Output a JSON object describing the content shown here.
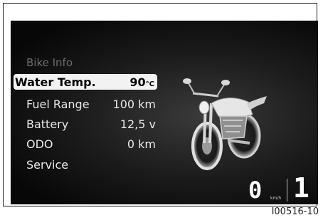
{
  "menu": {
    "title": "Bike Info",
    "items": [
      {
        "label": "Water Temp.",
        "value": "90",
        "unit": "°C",
        "selected": true
      },
      {
        "label": "Fuel Range",
        "value": "100 km",
        "unit": ""
      },
      {
        "label": "Battery",
        "value": "12,5 v",
        "unit": ""
      },
      {
        "label": "ODO",
        "value": "0 km",
        "unit": ""
      },
      {
        "label": "Service",
        "value": "",
        "unit": ""
      }
    ]
  },
  "status": {
    "speed": "0",
    "speed_unit": "km/h",
    "gear": "1"
  },
  "figure_id": "I00516-10",
  "icons": {
    "bike": "motorcycle-illustration"
  },
  "colors": {
    "screen_bg": "#111111",
    "highlight": "#f2f2f2",
    "text": "#e8e8e8",
    "muted": "#6d6d6d"
  }
}
